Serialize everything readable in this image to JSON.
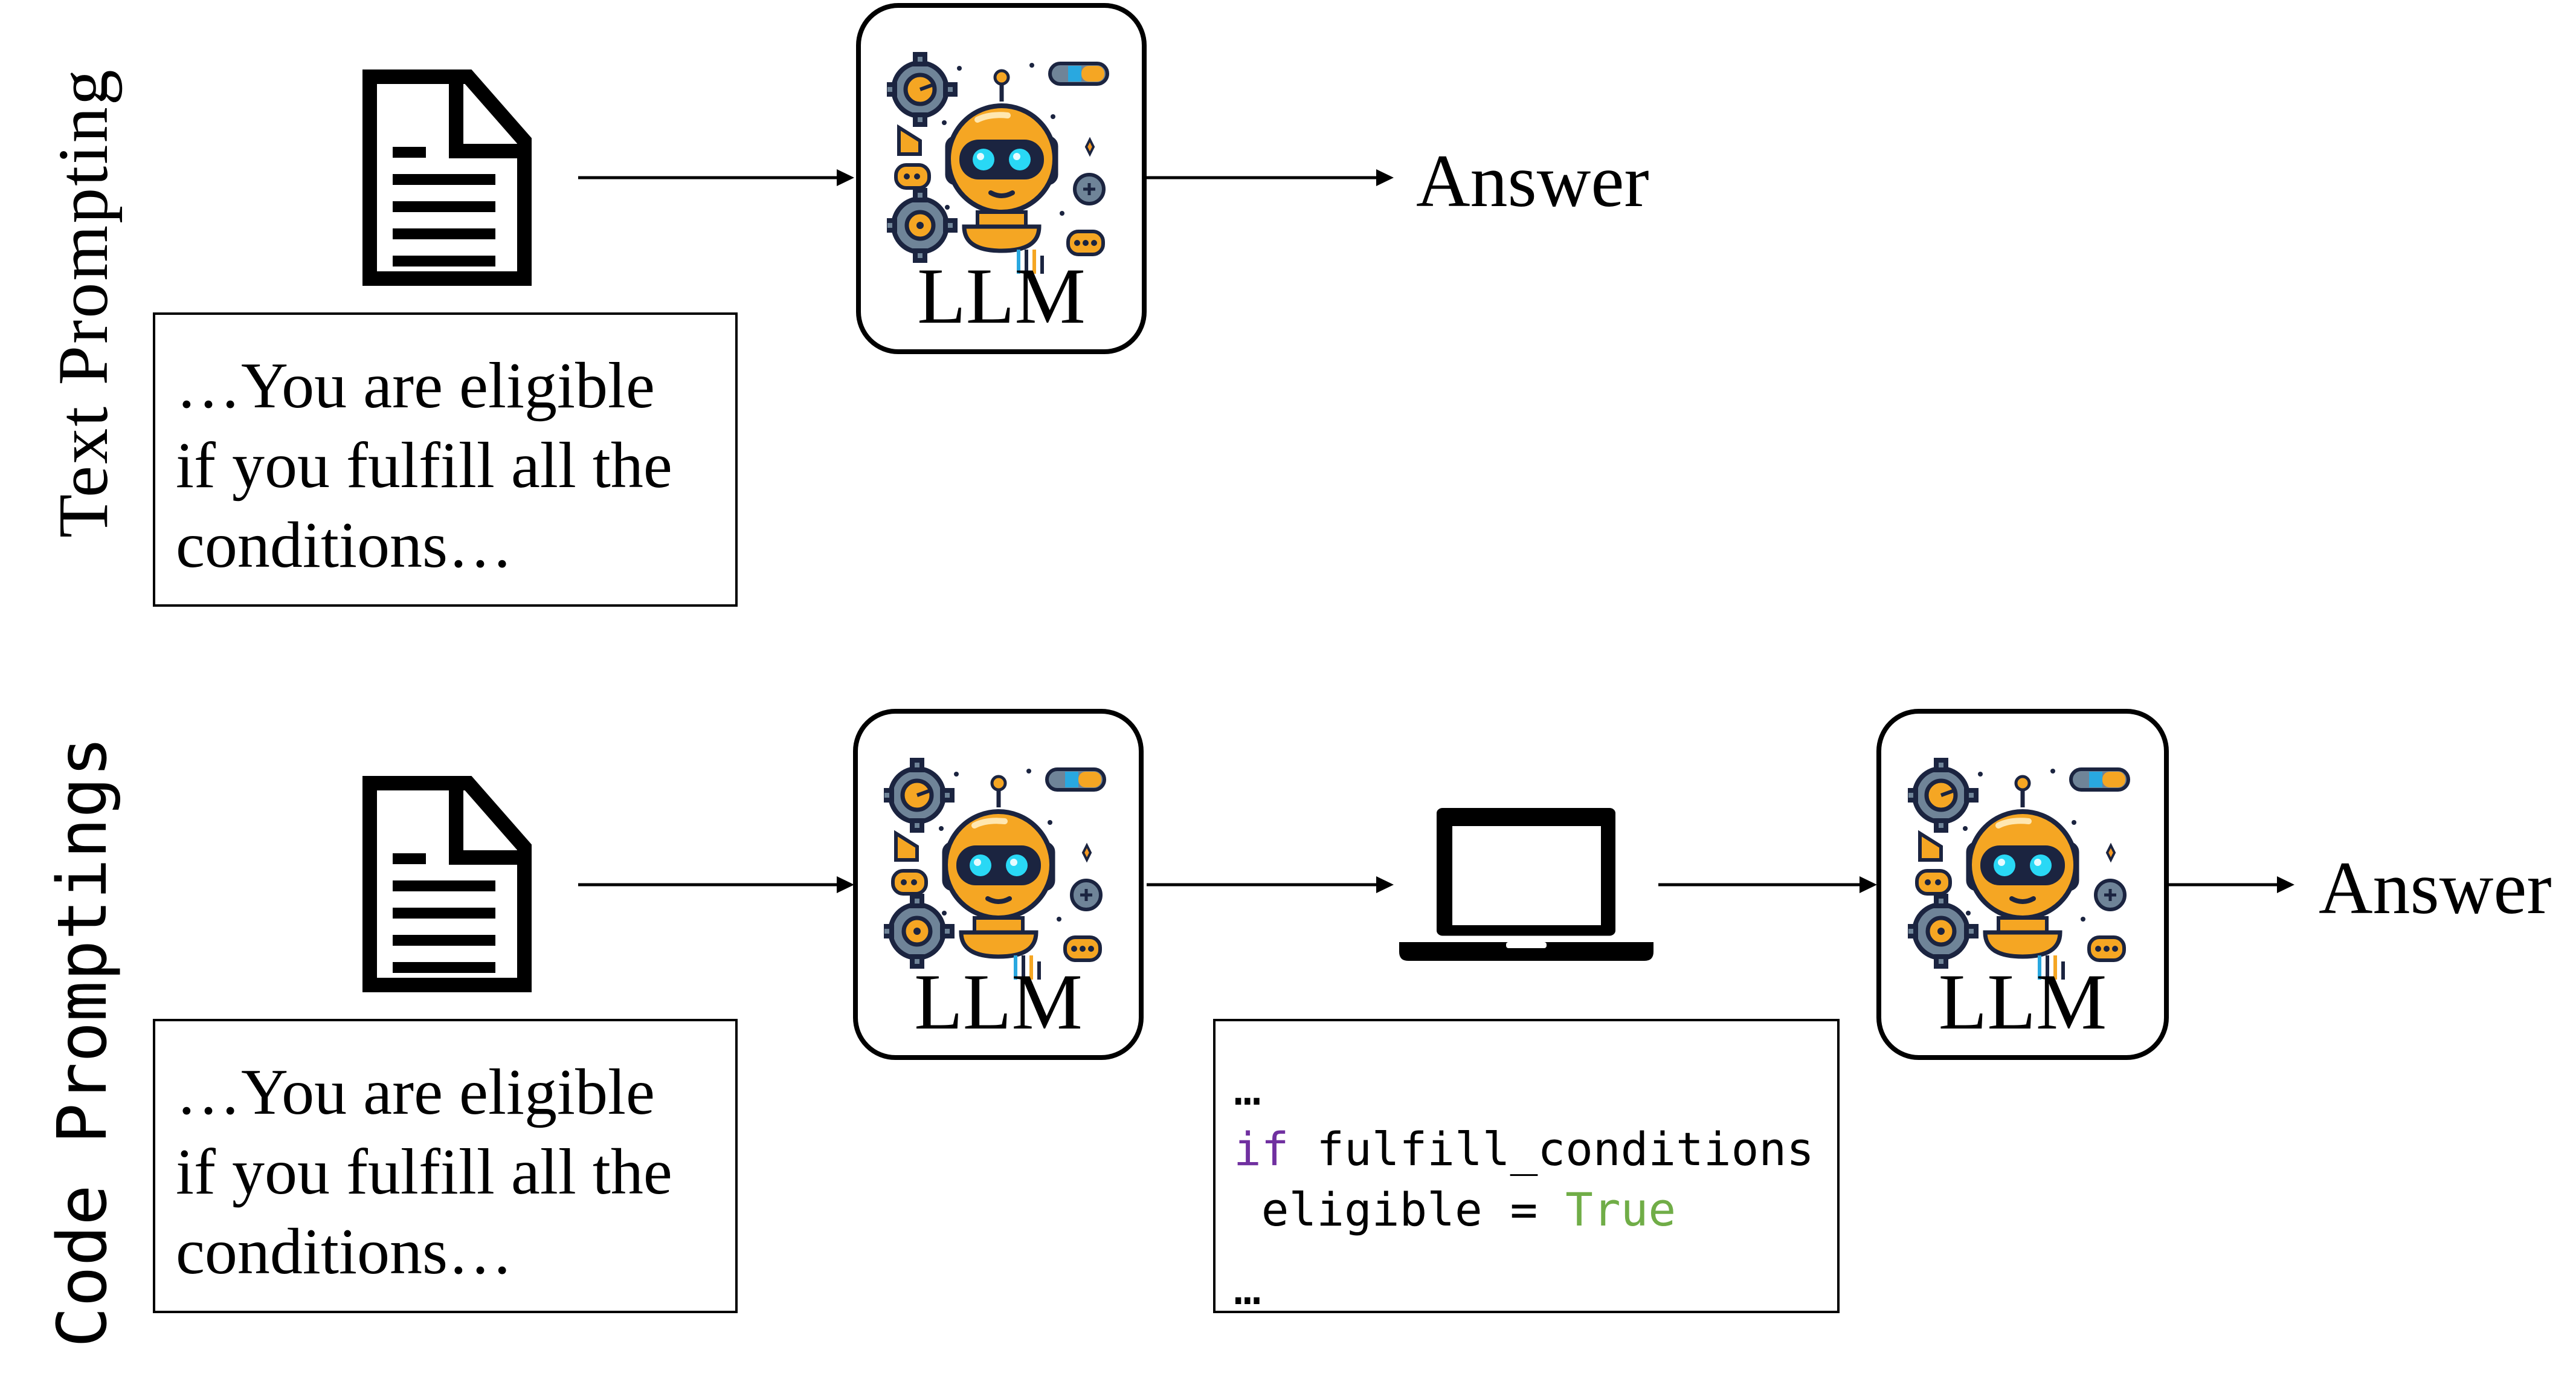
{
  "rows": [
    {
      "label": "Text Prompting",
      "input_text_lines": [
        "…You are eligible",
        "if you fulfill all the",
        "conditions…"
      ],
      "model_label": "LLM",
      "output_label": "Answer"
    },
    {
      "label": "Code Promptings",
      "input_text_lines": [
        "…You are eligible",
        "if you fulfill all the",
        "conditions…"
      ],
      "model_label": "LLM",
      "code": {
        "line1": "…",
        "line2_keyword": "if",
        "line2_rest": " fulfill_conditions",
        "line3_prefix": " eligible = ",
        "line3_literal": "True",
        "line4": "…"
      },
      "second_model_label": "LLM",
      "output_label": "Answer"
    }
  ],
  "icons": {
    "document": "document-icon",
    "robot": "robot-icon",
    "laptop": "laptop-icon",
    "arrow": "arrow-right-icon"
  },
  "colors": {
    "keyword": "#7030A0",
    "literal": "#70AD47",
    "robot_orange": "#F5A623",
    "robot_dark": "#1B2440",
    "robot_eye": "#29D8F5",
    "robot_gray": "#6F8498"
  }
}
